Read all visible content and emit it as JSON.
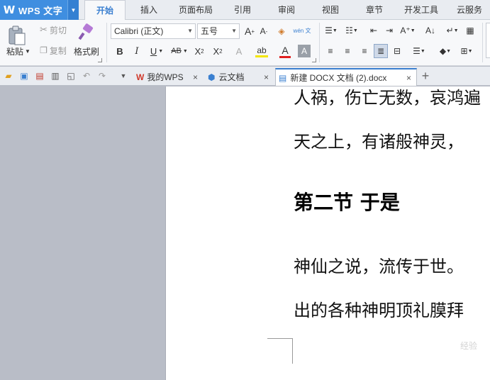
{
  "app": {
    "logo": "W",
    "title": "WPS 文字"
  },
  "menu": {
    "tabs": [
      {
        "label": "开始",
        "active": true
      },
      {
        "label": "插入"
      },
      {
        "label": "页面布局"
      },
      {
        "label": "引用"
      },
      {
        "label": "审阅"
      },
      {
        "label": "视图"
      },
      {
        "label": "章节"
      },
      {
        "label": "开发工具"
      },
      {
        "label": "云服务"
      }
    ]
  },
  "ribbon": {
    "paste_label": "粘贴",
    "cut_label": "剪切",
    "copy_label": "复制",
    "format_painter_label": "格式刷",
    "font_name": "Calibri (正文)",
    "font_size": "五号",
    "pinyin_icon_label": "wén 文",
    "colors": {
      "highlight": "#f3e600",
      "font_color": "#e02020",
      "accent": "#3a7fd0"
    }
  },
  "tabs": [
    {
      "label": "我的WPS",
      "icon": "wps-logo-icon"
    },
    {
      "label": "云文档",
      "icon": "cloud-doc-icon"
    },
    {
      "label": "新建 DOCX 文档 (2).docx",
      "icon": "document-icon",
      "active": true
    }
  ],
  "document": {
    "line1": "人祸，伤亡无数，哀鸿遍",
    "line2": "天之上，有诸般神灵，",
    "heading": "第二节  于是",
    "line3": "神仙之说，流传于世。",
    "line4": "出的各种神明顶礼膜拜"
  },
  "watermark": "经验"
}
